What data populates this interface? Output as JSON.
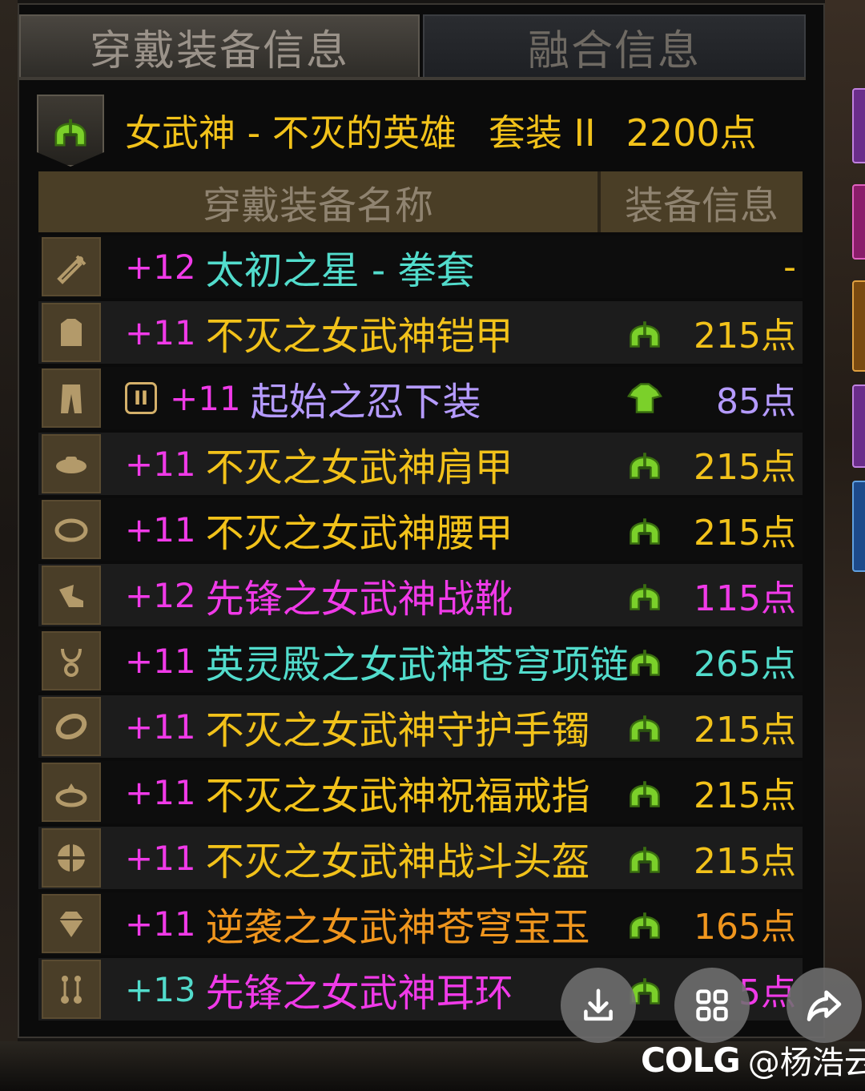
{
  "tabs": [
    {
      "label": "穿戴装备信息",
      "active": true
    },
    {
      "label": "融合信息",
      "active": false
    }
  ],
  "set": {
    "icon": "green-helmet-icon",
    "name": "女武神 - 不灭的英雄",
    "suit": "套装 II",
    "points": "2200点",
    "color": "#f2c21a"
  },
  "table": {
    "col_name": "穿戴装备名称",
    "col_info": "装备信息"
  },
  "items": [
    {
      "slot_icon": "weapon-icon",
      "plus": "+12",
      "name": "太初之星 - 拳套",
      "name_color": "#52dccc",
      "info_icon": "",
      "points": "-",
      "points_color": "#f2c21a"
    },
    {
      "slot_icon": "top-armor-icon",
      "plus": "+11",
      "name": "不灭之女武神铠甲",
      "name_color": "#f2c21a",
      "info_icon": "green-helmet-icon",
      "points": "215点",
      "points_color": "#f2c21a"
    },
    {
      "slot_icon": "pants-icon",
      "tag": "II",
      "plus": "+11",
      "name": "起始之忍下装",
      "name_color": "#b59bff",
      "info_icon": "green-armor-icon",
      "points": "85点",
      "points_color": "#b59bff"
    },
    {
      "slot_icon": "shoulder-icon",
      "plus": "+11",
      "name": "不灭之女武神肩甲",
      "name_color": "#f2c21a",
      "info_icon": "green-helmet-icon",
      "points": "215点",
      "points_color": "#f2c21a"
    },
    {
      "slot_icon": "belt-icon",
      "plus": "+11",
      "name": "不灭之女武神腰甲",
      "name_color": "#f2c21a",
      "info_icon": "green-helmet-icon",
      "points": "215点",
      "points_color": "#f2c21a"
    },
    {
      "slot_icon": "boots-icon",
      "plus": "+12",
      "name": "先锋之女武神战靴",
      "name_color": "#f03ae8",
      "info_icon": "green-helmet-icon",
      "points": "115点",
      "points_color": "#f03ae8"
    },
    {
      "slot_icon": "necklace-icon",
      "plus": "+11",
      "name": "英灵殿之女武神苍穹项链",
      "name_color": "#52dccc",
      "info_icon": "green-helmet-icon",
      "points": "265点",
      "points_color": "#52dccc"
    },
    {
      "slot_icon": "bracelet-icon",
      "plus": "+11",
      "name": "不灭之女武神守护手镯",
      "name_color": "#f2c21a",
      "info_icon": "green-helmet-icon",
      "points": "215点",
      "points_color": "#f2c21a"
    },
    {
      "slot_icon": "ring-icon",
      "plus": "+11",
      "name": "不灭之女武神祝福戒指",
      "name_color": "#f2c21a",
      "info_icon": "green-helmet-icon",
      "points": "215点",
      "points_color": "#f2c21a"
    },
    {
      "slot_icon": "subequip-icon",
      "plus": "+11",
      "name": "不灭之女武神战斗头盔",
      "name_color": "#f2c21a",
      "info_icon": "green-helmet-icon",
      "points": "215点",
      "points_color": "#f2c21a"
    },
    {
      "slot_icon": "gem-icon",
      "plus": "+11",
      "name": "逆袭之女武神苍穹宝玉",
      "name_color": "#f0961e",
      "info_icon": "green-helmet-icon",
      "points": "165点",
      "points_color": "#f0961e"
    },
    {
      "slot_icon": "earring-icon",
      "plus": "+13",
      "plus_color": "#52dccc",
      "name": "先锋之女武神耳环",
      "name_color": "#f03ae8",
      "info_icon": "green-helmet-icon",
      "points": "5点",
      "points_color": "#f03ae8"
    }
  ],
  "plus_color": "#f03ae8",
  "overlay": {
    "buttons": [
      {
        "icon": "download-icon"
      },
      {
        "icon": "grid-icon"
      },
      {
        "icon": "share-icon"
      }
    ],
    "watermark_logo": "COLG",
    "watermark_handle": "@杨浩云"
  }
}
